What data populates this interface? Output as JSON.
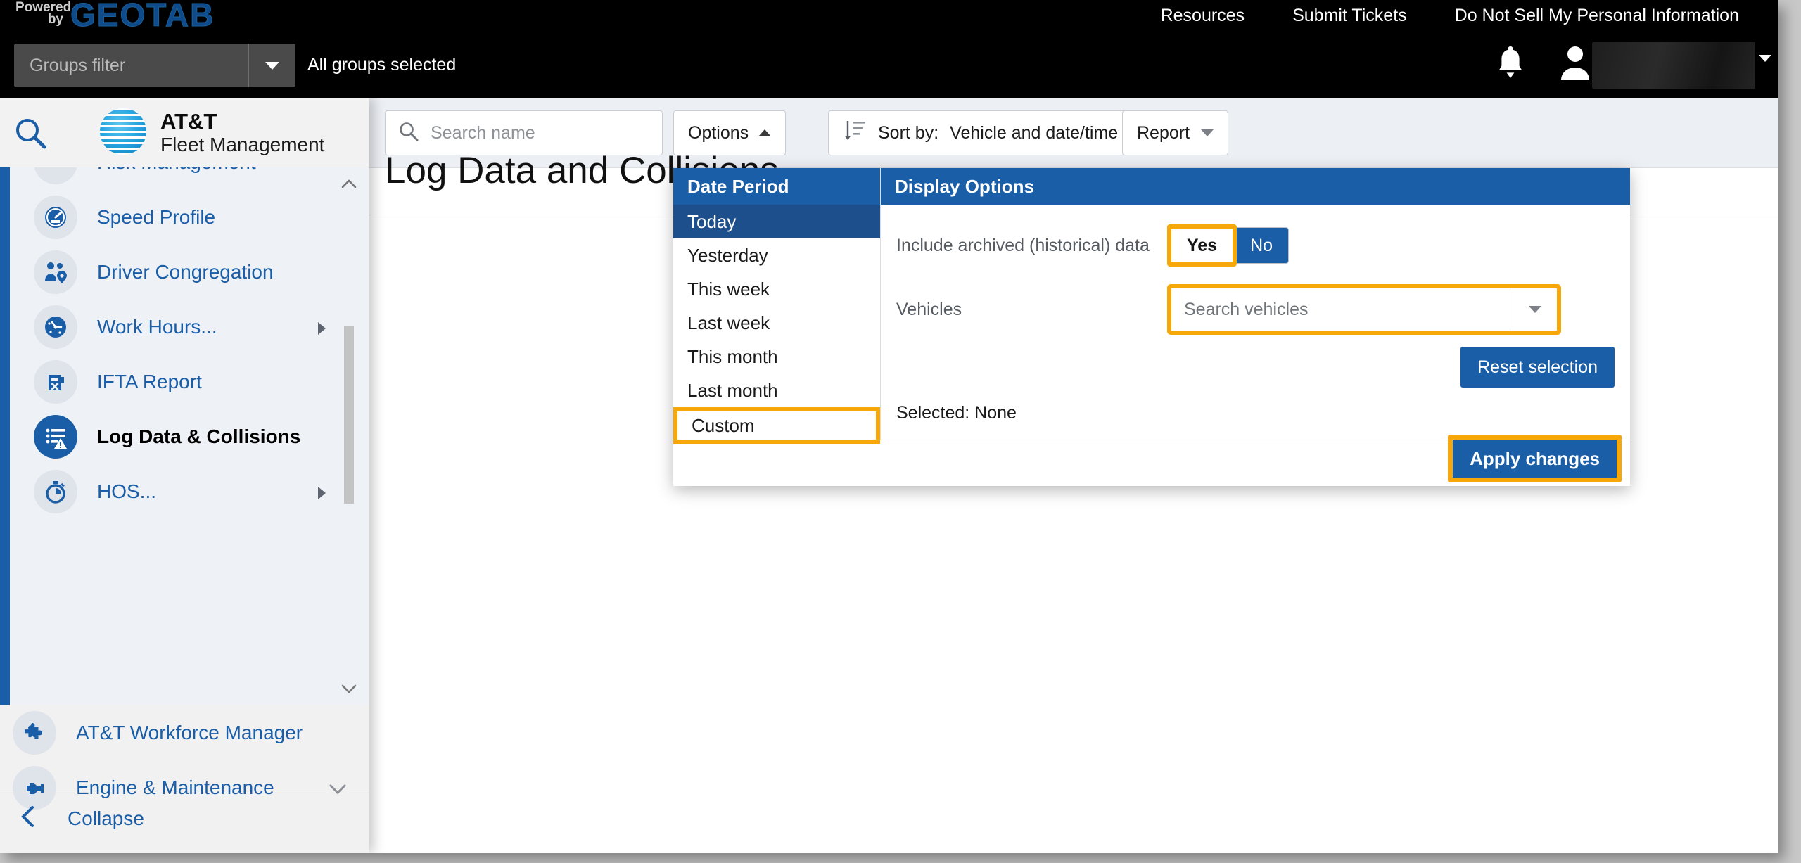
{
  "topbar": {
    "powered_line1": "Powered",
    "powered_line2": "by",
    "brand": "GEOTAB",
    "groups_filter_placeholder": "Groups filter",
    "all_groups_text": "All groups selected",
    "links": [
      {
        "label": "Resources"
      },
      {
        "label": "Submit Tickets"
      },
      {
        "label": "Do Not Sell My Personal Information"
      }
    ],
    "notifications_icon": "bell-icon",
    "account_icon": "user-avatar-icon",
    "account_name": ""
  },
  "sidebar": {
    "search_icon": "search-icon",
    "logo_title": "AT&T",
    "logo_subtitle": "Fleet Management",
    "items": [
      {
        "label": "Risk Management",
        "icon": "risk-management-icon",
        "has_submenu": false,
        "partial": true
      },
      {
        "label": "Speed Profile",
        "icon": "speedometer-icon",
        "has_submenu": false
      },
      {
        "label": "Driver Congregation",
        "icon": "driver-congregation-icon",
        "has_submenu": false
      },
      {
        "label": "Work Hours...",
        "icon": "clock-icon",
        "has_submenu": true
      },
      {
        "label": "IFTA Report",
        "icon": "fuel-can-icon",
        "has_submenu": false
      },
      {
        "label": "Log Data & Collisions",
        "icon": "log-data-collisions-icon",
        "has_submenu": false,
        "current": true
      },
      {
        "label": "HOS...",
        "icon": "stopwatch-icon",
        "has_submenu": true
      }
    ],
    "bottom_items": [
      {
        "label": "AT&T Workforce Manager",
        "icon": "puzzle-piece-icon",
        "expandable": false
      },
      {
        "label": "Engine & Maintenance",
        "icon": "engine-icon",
        "expandable": true
      }
    ],
    "collapse_label": "Collapse",
    "collapse_icon": "chevron-left-icon"
  },
  "toolbar": {
    "search_placeholder": "Search name",
    "search_icon": "search-icon",
    "options_label": "Options",
    "options_caret": "caret-up-icon",
    "sort_icon": "sort-descending-icon",
    "sort_label": "Sort by:",
    "sort_value": "Vehicle and date/time",
    "sort_caret": "caret-down-icon",
    "report_label": "Report",
    "report_caret": "caret-down-icon"
  },
  "page": {
    "title": "Log Data and Collisions"
  },
  "options_panel": {
    "date_period": {
      "header": "Date Period",
      "items": [
        {
          "label": "Today",
          "selected": true
        },
        {
          "label": "Yesterday"
        },
        {
          "label": "This week"
        },
        {
          "label": "Last week"
        },
        {
          "label": "This month"
        },
        {
          "label": "Last month"
        },
        {
          "label": "Custom",
          "highlighted": true
        }
      ]
    },
    "display_options": {
      "header": "Display Options",
      "archived_label": "Include archived (historical) data",
      "archived_yes": "Yes",
      "archived_no": "No",
      "archived_value": "No",
      "archived_highlight": "Yes",
      "vehicles_label": "Vehicles",
      "vehicles_placeholder": "Search vehicles",
      "vehicles_caret": "caret-down-icon",
      "reset_label": "Reset selection",
      "selected_text": "Selected: None"
    },
    "apply_label": "Apply changes"
  },
  "colors": {
    "brand_blue": "#1b5ea8",
    "selected_blue": "#1c4f8c",
    "highlight_orange": "#f6a70a",
    "topbar_black": "#000000",
    "toolbar_grey": "#eceff4",
    "sidebar_grey": "#f1f1f1",
    "nav_grey": "#eef1f6"
  }
}
